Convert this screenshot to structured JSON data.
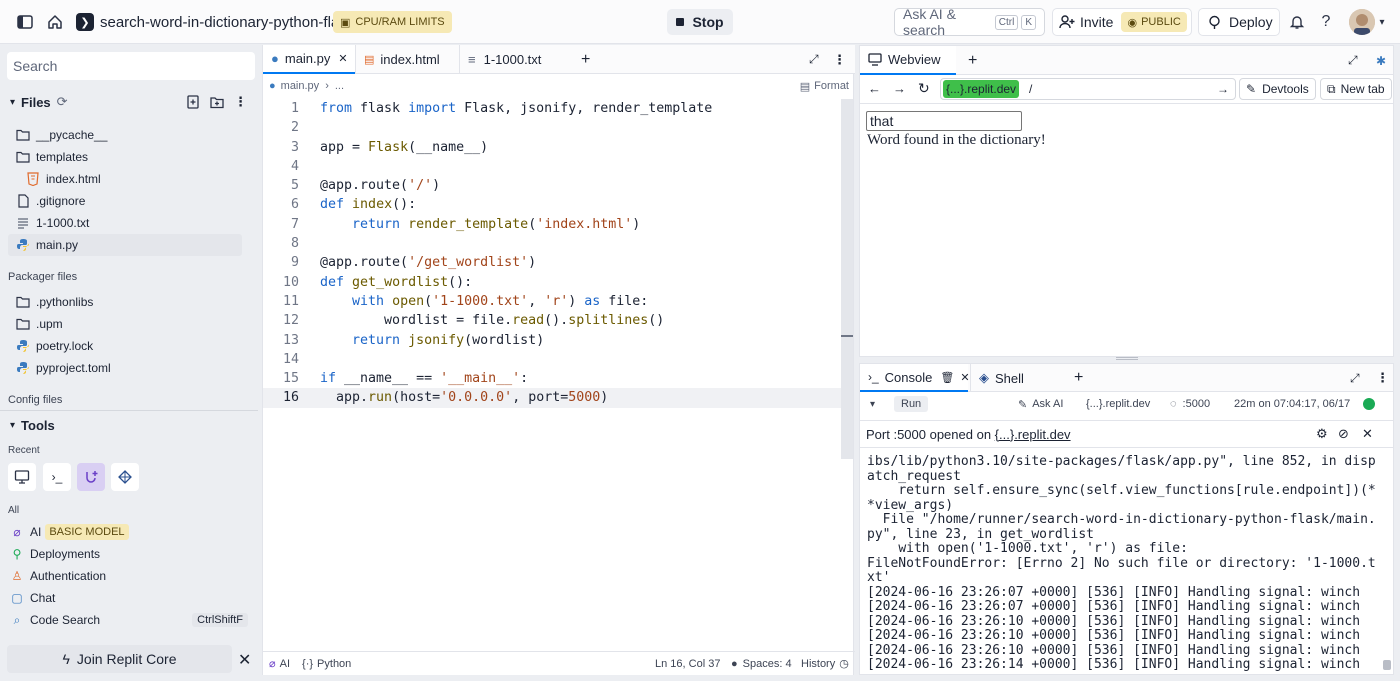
{
  "topbar": {
    "repl_name": "search-word-in-dictionary-python-flask",
    "limits_label": "CPU/RAM LIMITS",
    "stop_label": "Stop",
    "ask_ai_label": "Ask AI & search",
    "ask_ai_kbd1": "Ctrl",
    "ask_ai_kbd2": "K",
    "invite_label": "Invite",
    "public_label": "PUBLIC",
    "deploy_label": "Deploy"
  },
  "sidebar": {
    "search_placeholder": "Search",
    "files_label": "Files",
    "files": [
      {
        "name": "__pycache__",
        "icon": "folder-icon"
      },
      {
        "name": "templates",
        "icon": "folder-icon"
      },
      {
        "name": "index.html",
        "icon": "html-file-icon"
      },
      {
        "name": ".gitignore",
        "icon": "file-icon"
      },
      {
        "name": "1-1000.txt",
        "icon": "text-file-icon"
      },
      {
        "name": "main.py",
        "icon": "python-icon"
      }
    ],
    "packager_label": "Packager files",
    "packager_files": [
      {
        "name": ".pythonlibs",
        "icon": "folder-icon"
      },
      {
        "name": ".upm",
        "icon": "folder-icon"
      },
      {
        "name": "poetry.lock",
        "icon": "python-icon"
      },
      {
        "name": "pyproject.toml",
        "icon": "python-icon"
      }
    ],
    "config_label": "Config files",
    "tools_label": "Tools",
    "recent_label": "Recent",
    "all_label": "All",
    "tools": [
      {
        "name": "AI",
        "badge": "BASIC MODEL"
      },
      {
        "name": "Deployments"
      },
      {
        "name": "Authentication"
      },
      {
        "name": "Chat"
      },
      {
        "name": "Code Search",
        "shortcut": "CtrlShiftF"
      }
    ],
    "join_core_label": "Join Replit Core"
  },
  "editor": {
    "tabs": [
      "main.py",
      "index.html",
      "1-1000.txt"
    ],
    "breadcrumb_file": "main.py",
    "breadcrumb_more": "...",
    "format_label": "Format",
    "status": {
      "ai": "AI",
      "lang": "Python",
      "position": "Ln 16, Col 37",
      "spaces": "Spaces: 4",
      "history": "History"
    }
  },
  "webview": {
    "tab_label": "Webview",
    "url_host": "{...}.replit.dev",
    "url_path": "/",
    "devtools_label": "Devtools",
    "newtab_label": "New tab",
    "input_value": "that",
    "result_text": "Word found in the dictionary!"
  },
  "console": {
    "tab_console": "Console",
    "tab_shell": "Shell",
    "run_label": "Run",
    "ask_ai_label": "Ask AI",
    "host_label": "{...}.replit.dev",
    "port_label": ":5000",
    "time_label": "22m on 07:04:17, 06/17",
    "port_prefix": "Port :5000 opened on ",
    "port_host": "{...}.replit.dev",
    "log": [
      "ibs/lib/python3.10/site-packages/flask/app.py\", line 852, in dispatch_request",
      "    return self.ensure_sync(self.view_functions[rule.endpoint])(**view_args)",
      "  File \"/home/runner/search-word-in-dictionary-python-flask/main.py\", line 23, in get_wordlist",
      "    with open('1-1000.txt', 'r') as file:",
      "FileNotFoundError: [Errno 2] No such file or directory: '1-1000.txt'",
      "[2024-06-16 23:26:07 +0000] [536] [INFO] Handling signal: winch",
      "[2024-06-16 23:26:07 +0000] [536] [INFO] Handling signal: winch",
      "[2024-06-16 23:26:10 +0000] [536] [INFO] Handling signal: winch",
      "[2024-06-16 23:26:10 +0000] [536] [INFO] Handling signal: winch",
      "[2024-06-16 23:26:10 +0000] [536] [INFO] Handling signal: winch",
      "[2024-06-16 23:26:14 +0000] [536] [INFO] Handling signal: winch"
    ]
  },
  "code_lines": [
    [
      {
        "t": "from",
        "c": "kw"
      },
      {
        "t": " flask "
      },
      {
        "t": "import",
        "c": "kw"
      },
      {
        "t": " Flask, jsonify, render_template"
      }
    ],
    [],
    [
      {
        "t": "app = "
      },
      {
        "t": "Flask",
        "c": "fn"
      },
      {
        "t": "(__name__)"
      }
    ],
    [],
    [
      {
        "t": "@app.route("
      },
      {
        "t": "'/'",
        "c": "str"
      },
      {
        "t": ")"
      }
    ],
    [
      {
        "t": "def",
        "c": "kw"
      },
      {
        "t": " "
      },
      {
        "t": "index",
        "c": "fn"
      },
      {
        "t": "():"
      }
    ],
    [
      {
        "t": "    "
      },
      {
        "t": "return",
        "c": "kw"
      },
      {
        "t": " "
      },
      {
        "t": "render_template",
        "c": "fn"
      },
      {
        "t": "("
      },
      {
        "t": "'index.html'",
        "c": "str"
      },
      {
        "t": ")"
      }
    ],
    [],
    [
      {
        "t": "@app.route("
      },
      {
        "t": "'/get_wordlist'",
        "c": "str"
      },
      {
        "t": ")"
      }
    ],
    [
      {
        "t": "def",
        "c": "kw"
      },
      {
        "t": " "
      },
      {
        "t": "get_wordlist",
        "c": "fn"
      },
      {
        "t": "():"
      }
    ],
    [
      {
        "t": "    "
      },
      {
        "t": "with",
        "c": "kw"
      },
      {
        "t": " "
      },
      {
        "t": "open",
        "c": "fn"
      },
      {
        "t": "("
      },
      {
        "t": "'1-1000.txt'",
        "c": "str"
      },
      {
        "t": ", "
      },
      {
        "t": "'r'",
        "c": "str"
      },
      {
        "t": ") "
      },
      {
        "t": "as",
        "c": "kw"
      },
      {
        "t": " file:"
      }
    ],
    [
      {
        "t": "        wordlist = file."
      },
      {
        "t": "read",
        "c": "fn"
      },
      {
        "t": "()."
      },
      {
        "t": "splitlines",
        "c": "fn"
      },
      {
        "t": "()"
      }
    ],
    [
      {
        "t": "    "
      },
      {
        "t": "return",
        "c": "kw"
      },
      {
        "t": " "
      },
      {
        "t": "jsonify",
        "c": "fn"
      },
      {
        "t": "(wordlist)"
      }
    ],
    [],
    [
      {
        "t": "if",
        "c": "kw"
      },
      {
        "t": " __name__ == "
      },
      {
        "t": "'__main__'",
        "c": "str"
      },
      {
        "t": ":"
      }
    ],
    [
      {
        "t": "  app."
      },
      {
        "t": "run",
        "c": "fn"
      },
      {
        "t": "(host="
      },
      {
        "t": "'0.0.0.0'",
        "c": "str"
      },
      {
        "t": ", port="
      },
      {
        "t": "5000",
        "c": "str"
      },
      {
        "t": ")"
      }
    ]
  ]
}
